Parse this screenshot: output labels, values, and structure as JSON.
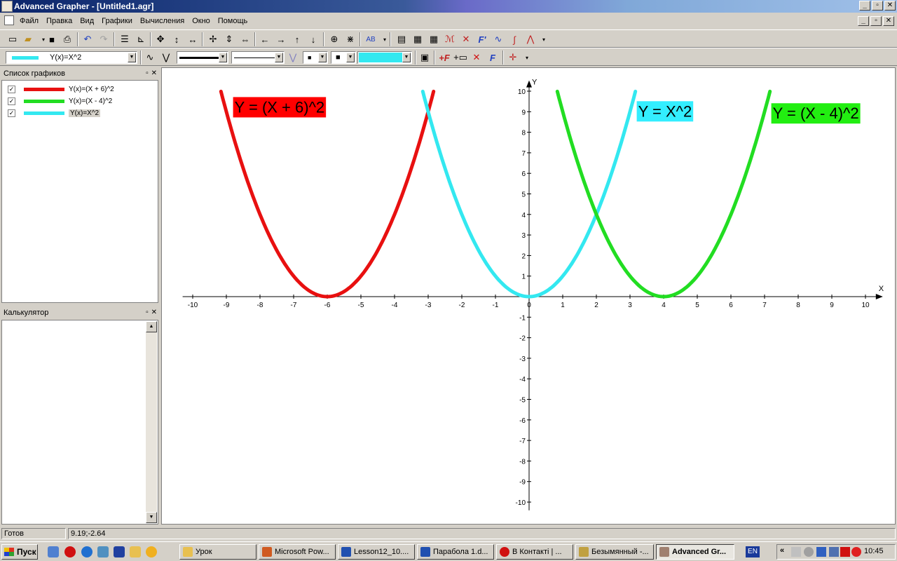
{
  "window": {
    "title": "Advanced Grapher - [Untitled1.agr]"
  },
  "menu": [
    "Файл",
    "Правка",
    "Вид",
    "Графики",
    "Вычисления",
    "Окно",
    "Помощь"
  ],
  "toolbar2": {
    "current_graph": "Y(x)=X^2",
    "color": "#33e8f0"
  },
  "graph_list": {
    "title": "Список графиков",
    "items": [
      {
        "label": "Y(x)=(X + 6)^2",
        "color": "#e81010",
        "checked": "✓"
      },
      {
        "label": "Y(x)=(X - 4)^2",
        "color": "#22dd22",
        "checked": "✓"
      },
      {
        "label": "Y(x)=X^2",
        "color": "#33e8f0",
        "checked": "✓"
      }
    ]
  },
  "calculator": {
    "title": "Калькулятор"
  },
  "chart_data": {
    "type": "line",
    "xlim": [
      -10,
      10
    ],
    "ylim": [
      -10,
      10
    ],
    "xlabel": "X",
    "ylabel": "Y",
    "x_ticks": [
      -10,
      -9,
      -8,
      -7,
      -6,
      -5,
      -4,
      -3,
      -2,
      -1,
      0,
      1,
      2,
      3,
      4,
      5,
      6,
      7,
      8,
      9,
      10
    ],
    "y_ticks": [
      -10,
      -9,
      -8,
      -7,
      -6,
      -5,
      -4,
      -3,
      -2,
      -1,
      1,
      2,
      3,
      4,
      5,
      6,
      7,
      8,
      9,
      10
    ],
    "grid": false,
    "series": [
      {
        "name": "Y = (X + 6)^2",
        "shift": -6,
        "color": "#e81010",
        "x_range": [
          -9.16,
          -2.84
        ]
      },
      {
        "name": "Y = X^2",
        "shift": 0,
        "color": "#33e8f0",
        "x_range": [
          -3.16,
          3.16
        ]
      },
      {
        "name": "Y = (X - 4)^2",
        "shift": 4,
        "color": "#22dd22",
        "x_range": [
          0.84,
          7.16
        ]
      }
    ],
    "annotations": [
      {
        "text": "Y = (X + 6)^2",
        "bg": "#ff0000",
        "at": [
          -8.8,
          9.2
        ]
      },
      {
        "text": "Y = X^2",
        "bg": "#33eeff",
        "at": [
          3.2,
          9.0
        ]
      },
      {
        "text": "Y = (X - 4)^2",
        "bg": "#22ee11",
        "at": [
          7.2,
          8.9
        ]
      }
    ]
  },
  "status": {
    "text": "Готов",
    "coords": "9.19;-2.64"
  },
  "taskbar": {
    "start": "Пуск",
    "tasks": [
      {
        "label": "Урок",
        "color": "#e8c050"
      },
      {
        "label": "Microsoft Pow...",
        "color": "#d05a20"
      },
      {
        "label": "Lesson12_10....",
        "color": "#2050b0"
      },
      {
        "label": "Парабола 1.d...",
        "color": "#2050b0"
      },
      {
        "label": "В Контакті | ...",
        "color": "#d01010"
      },
      {
        "label": "Безымянный -...",
        "color": "#c0a040"
      },
      {
        "label": "Advanced Gr...",
        "color": "#a08070"
      }
    ],
    "lang": "EN",
    "time": "10:45"
  }
}
